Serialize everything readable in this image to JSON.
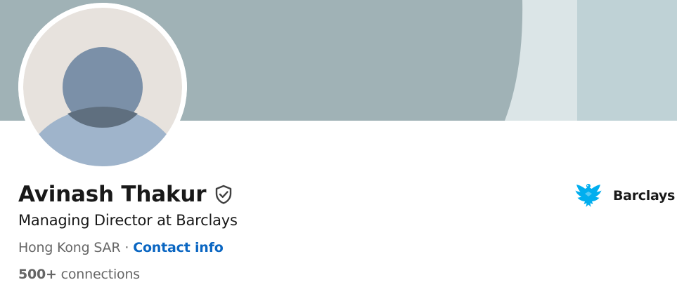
{
  "profile": {
    "name": "Avinash Thakur",
    "headline": "Managing Director at Barclays",
    "location": "Hong Kong SAR",
    "separator": "·",
    "contact_info_label": "Contact info",
    "connections_count": "500+",
    "connections_label": "connections"
  },
  "company": {
    "name": "Barclays",
    "logo_icon": "barclays-eagle-icon",
    "logo_color": "#00aeef"
  },
  "icons": {
    "verified": "verified-shield-icon",
    "avatar": "default-avatar-icon"
  },
  "colors": {
    "cover_base": "#a0b2b6",
    "cover_light": "#dbe5e7",
    "cover_mid": "#bfd2d6",
    "avatar_bg": "#e7e2dd",
    "avatar_head": "#7b90a8",
    "avatar_body": "#9fb4cb",
    "link": "#0a66c2",
    "text_primary": "#191919",
    "text_secondary": "#666666"
  }
}
